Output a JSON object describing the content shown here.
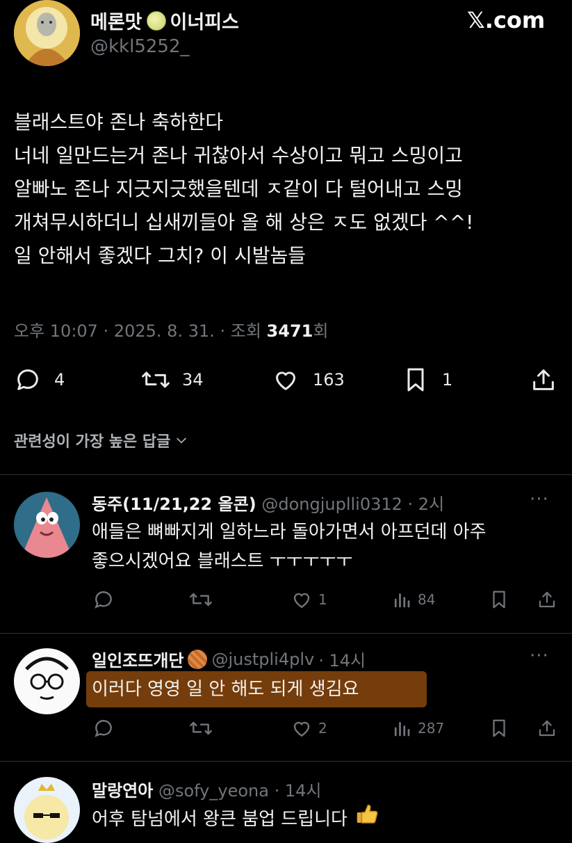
{
  "site_logo": "𝕏.com",
  "main_tweet": {
    "display_name": "메론맛",
    "display_name_suffix": "이너피스",
    "handle": "@kkl5252_",
    "lines": [
      "블래스트야 존나 축하한다",
      "너네 일만드는거 존나 귀찮아서 수상이고 뭐고 스밍이고",
      "알빠노 존나 지긋지긋했을텐데 ㅈ같이 다 털어내고 스밍",
      "개쳐무시하더니 십새끼들아 올 해 상은 ㅈ도 없겠다 ^^!",
      "일 안해서 좋겠다 그치? 이 시발놈들"
    ],
    "meta_prefix": "오후 10:07 · 2025. 8. 31. · 조회 ",
    "views": "3471",
    "views_suffix": "회",
    "stats": {
      "replies": "4",
      "retweets": "34",
      "likes": "163",
      "bookmarks": "1"
    }
  },
  "replies_sort_label": "관련성이 가장 높은 답글",
  "replies": [
    {
      "display_name": "동주(11/21,22 올콘)",
      "handle": "@dongjuplli0312",
      "time": "· 2시",
      "lines": [
        "애들은 뼈빠지게 일하느라 돌아가면서 아프던데 아주",
        "좋으시겠어요 블래스트 ㅜㅜㅜㅜㅜ"
      ],
      "stats": {
        "likes": "1",
        "views": "84"
      }
    },
    {
      "display_name": "일인조뜨개단",
      "handle": "@justpli4plv",
      "time": "· 14시",
      "lines": [
        "이러다 영영 일 안 해도 되게 생김요"
      ],
      "stats": {
        "likes": "2",
        "views": "287"
      }
    },
    {
      "display_name": "말랑연아",
      "handle": "@sofy_yeona",
      "time": "· 14시",
      "lines": [
        "어후 탐넘에서 왕큰 붐업 드립니다"
      ]
    }
  ],
  "colors": {
    "background": "#000000",
    "text": "#e7e9ea",
    "muted": "#71767b",
    "highlight": "#d67014"
  }
}
